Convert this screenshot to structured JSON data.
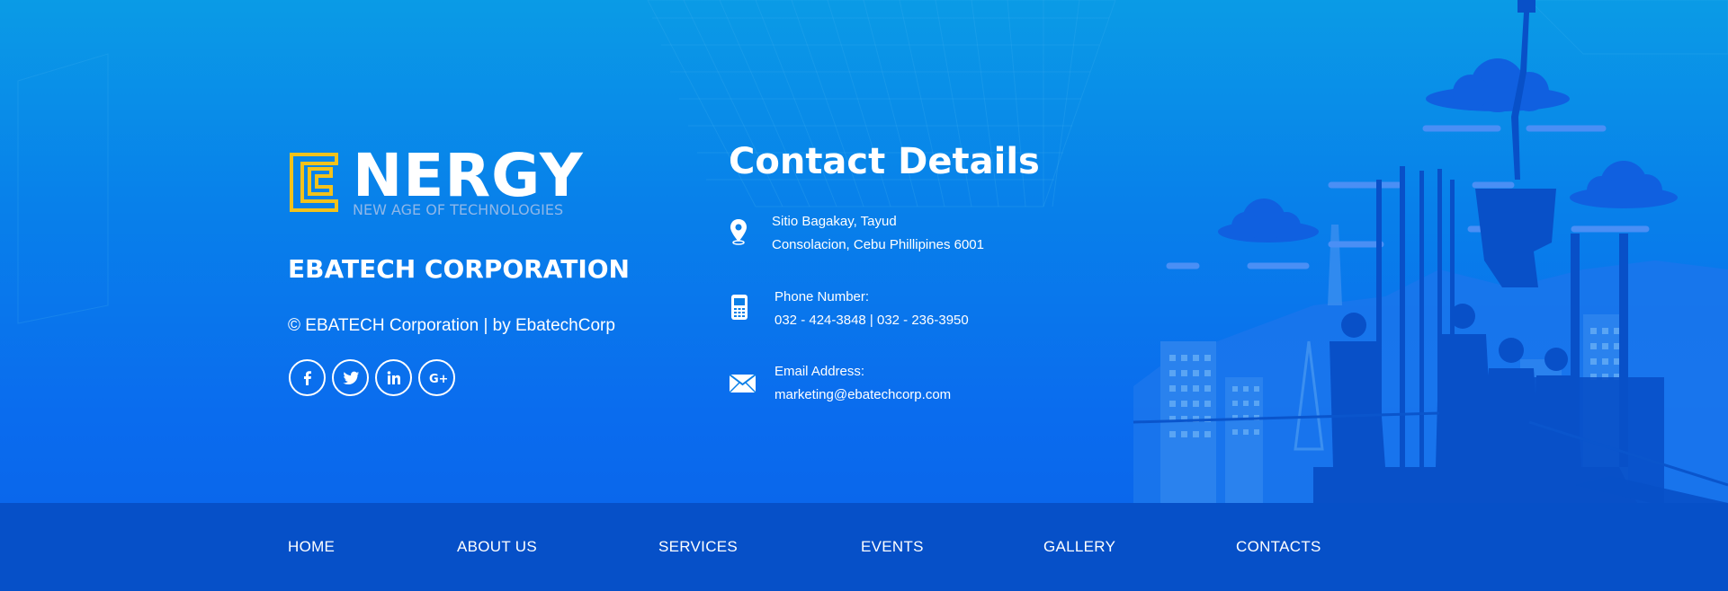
{
  "brand": {
    "logo_word": "NERGY",
    "logo_tagline": "NEW AGE OF TECHNOLOGIES",
    "company_name": "EBATECH CORPORATION",
    "copyright": "© EBATECH Corporation  |  by EbatechCorp"
  },
  "social": [
    {
      "icon": "facebook-icon",
      "glyph": "f"
    },
    {
      "icon": "twitter-icon",
      "glyph": "bird"
    },
    {
      "icon": "linkedin-icon",
      "glyph": "in"
    },
    {
      "icon": "google-plus-icon",
      "glyph": "G+"
    }
  ],
  "contact": {
    "title": "Contact Details",
    "address_line1": "Sitio Bagakay, Tayud",
    "address_line2": "Consolacion, Cebu Phillipines 6001",
    "phone_label": "Phone Number:",
    "phone_value": "032 - 424-3848 | 032 - 236-3950",
    "email_label": "Email Address:",
    "email_value": "marketing@ebatechcorp.com"
  },
  "nav": {
    "home": "HOME",
    "about": "ABOUT US",
    "services": "SERVICES",
    "events": "EVENTS",
    "gallery": "GALLERY",
    "contacts": "CONTACTS"
  },
  "colors": {
    "background_top": "#0a9be6",
    "background_bottom": "#0a62ea",
    "navbar": "#0650c8",
    "logo_accent": "#f2c21b",
    "text": "#ffffff"
  }
}
